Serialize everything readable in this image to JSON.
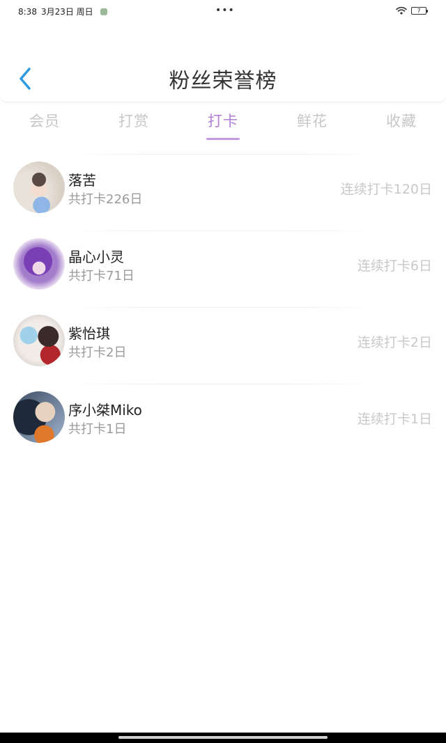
{
  "status_bar": {
    "time": "8:38",
    "date": "3月23日 周日",
    "dots": "•••",
    "battery": "7"
  },
  "header": {
    "back_icon": "chevron-left-icon",
    "title": "粉丝荣誉榜",
    "accent_color": "#2f9be0"
  },
  "tabs": [
    {
      "label": "会员",
      "active": false
    },
    {
      "label": "打赏",
      "active": false
    },
    {
      "label": "打卡",
      "active": true
    },
    {
      "label": "鲜花",
      "active": false
    },
    {
      "label": "收藏",
      "active": false
    }
  ],
  "active_tab_color": "#b27fd3",
  "fans": [
    {
      "name": "落苦",
      "total": "共打卡226日",
      "streak": "连续打卡120日"
    },
    {
      "name": "晶心小灵",
      "total": "共打卡71日",
      "streak": "连续打卡6日"
    },
    {
      "name": "紫怡琪",
      "total": "共打卡2日",
      "streak": "连续打卡2日"
    },
    {
      "name": "序小桀Miko",
      "total": "共打卡1日",
      "streak": "连续打卡1日"
    }
  ]
}
